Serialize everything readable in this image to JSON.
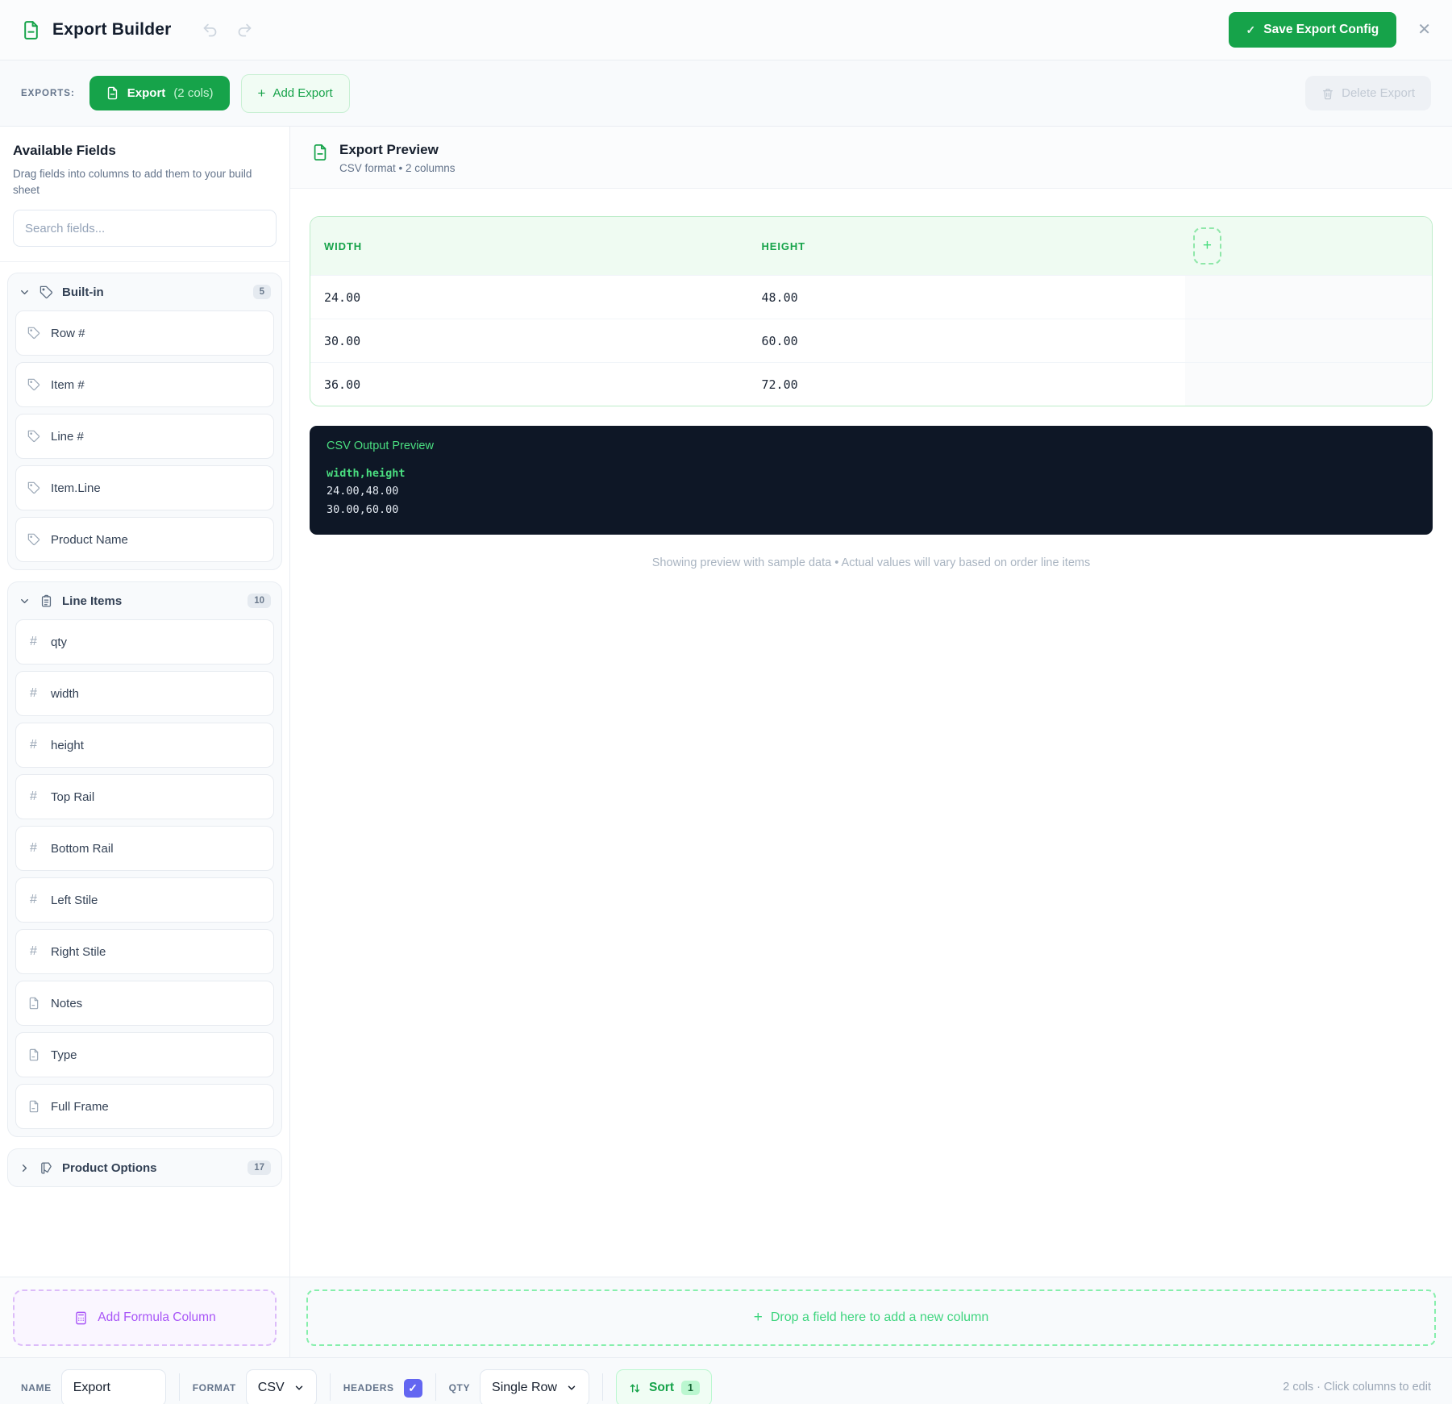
{
  "app": {
    "title": "Export Builder"
  },
  "header": {
    "save_label": "Save Export Config"
  },
  "exports_bar": {
    "label": "EXPORTS:",
    "active": {
      "name": "Export",
      "cols": "(2 cols)"
    },
    "add_label": "Add Export",
    "delete_label": "Delete Export"
  },
  "sidebar": {
    "title": "Available Fields",
    "description": "Drag fields into columns to add them to your build sheet",
    "search_placeholder": "Search fields...",
    "sections": [
      {
        "label": "Built-in",
        "count": "5",
        "icon": "tag-icon",
        "expanded": true,
        "items": [
          {
            "label": "Row #",
            "icon": "tag-icon"
          },
          {
            "label": "Item #",
            "icon": "tag-icon"
          },
          {
            "label": "Line #",
            "icon": "tag-icon"
          },
          {
            "label": "Item.Line",
            "icon": "tag-icon"
          },
          {
            "label": "Product Name",
            "icon": "tag-icon"
          }
        ]
      },
      {
        "label": "Line Items",
        "count": "10",
        "icon": "clipboard-icon",
        "expanded": true,
        "items": [
          {
            "label": "qty",
            "icon": "hash-icon"
          },
          {
            "label": "width",
            "icon": "hash-icon"
          },
          {
            "label": "height",
            "icon": "hash-icon"
          },
          {
            "label": "Top Rail",
            "icon": "hash-icon"
          },
          {
            "label": "Bottom Rail",
            "icon": "hash-icon"
          },
          {
            "label": "Left Stile",
            "icon": "hash-icon"
          },
          {
            "label": "Right Stile",
            "icon": "hash-icon"
          },
          {
            "label": "Notes",
            "icon": "document-icon"
          },
          {
            "label": "Type",
            "icon": "document-icon"
          },
          {
            "label": "Full Frame",
            "icon": "document-icon"
          }
        ]
      },
      {
        "label": "Product Options",
        "count": "17",
        "icon": "swatch-icon",
        "expanded": false,
        "items": []
      }
    ],
    "add_formula_label": "Add Formula Column"
  },
  "preview": {
    "title": "Export Preview",
    "subtitle": "CSV format • 2 columns",
    "table": {
      "columns": [
        "WIDTH",
        "HEIGHT"
      ],
      "rows": [
        [
          "24.00",
          "48.00"
        ],
        [
          "30.00",
          "60.00"
        ],
        [
          "36.00",
          "72.00"
        ]
      ]
    },
    "csv": {
      "title": "CSV Output Preview",
      "header_line": "width,height",
      "lines": [
        "24.00,48.00",
        "30.00,60.00"
      ]
    },
    "caption": "Showing preview with sample data • Actual values will vary based on order line items",
    "drop_label": "Drop a field here to add a new column"
  },
  "bottom_bar": {
    "name_label": "NAME",
    "name_value": "Export",
    "format_label": "FORMAT",
    "format_value": "CSV",
    "headers_label": "HEADERS",
    "headers_checked": true,
    "qty_label": "QTY",
    "qty_value": "Single Row",
    "sort_label": "Sort",
    "sort_count": "1",
    "status": "2 cols · Click columns to edit"
  },
  "colors": {
    "accent_green": "#16a34a",
    "light_green_bg": "#f0fdf4",
    "green_border": "#bbf7d0",
    "code_bg": "#0f172a",
    "code_green": "#4ade80",
    "purple": "#a855f7",
    "checkbox_indigo": "#6366f1"
  }
}
